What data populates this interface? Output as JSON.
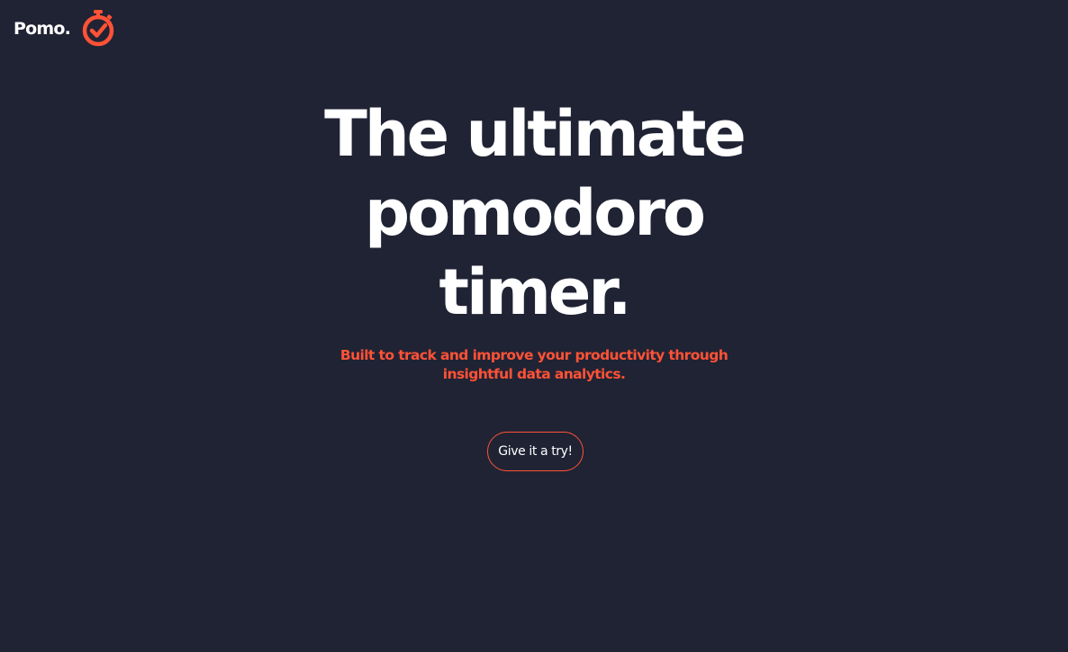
{
  "header": {
    "brand_name": "Pomo.",
    "logo_icon": "stopwatch-check-icon",
    "accent_color": "#ff5236"
  },
  "hero": {
    "title_lines": [
      "The ultimate",
      "pomodoro",
      "timer."
    ],
    "tagline_lines": [
      "Built to track and improve your productivity through",
      "insightful data analytics."
    ],
    "cta_label": "Give it a try!"
  },
  "theme": {
    "background": "#202334",
    "text": "#ffffff",
    "accent": "#ff5236"
  }
}
